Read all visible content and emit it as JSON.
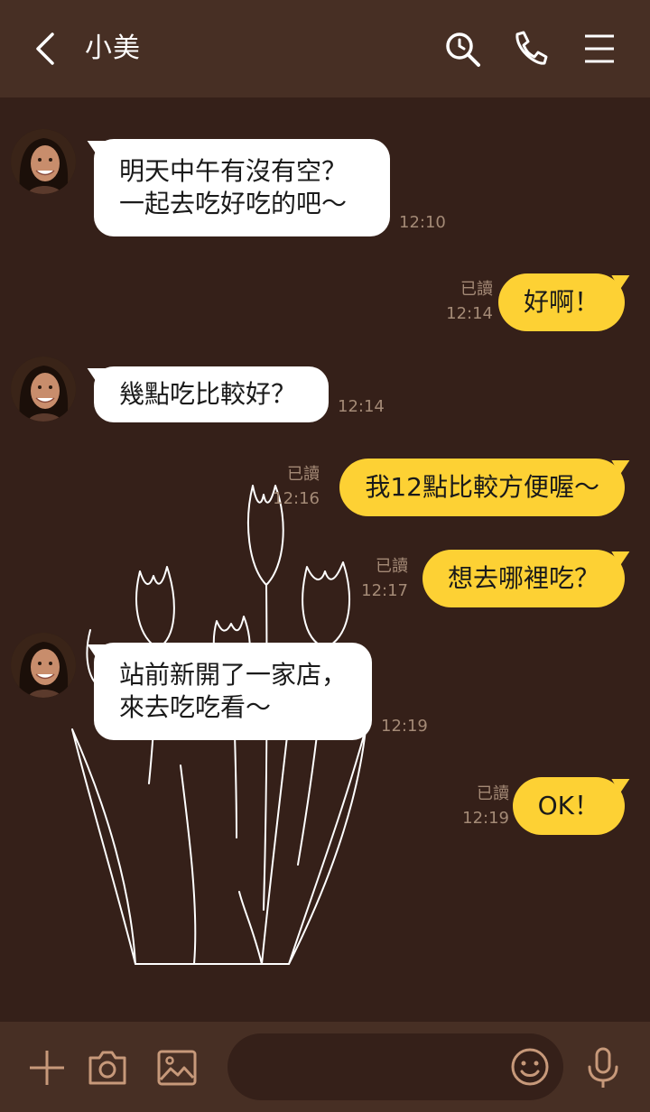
{
  "header": {
    "contact_name": "小美",
    "icons": [
      "back-icon",
      "search-icon",
      "phone-icon",
      "menu-icon"
    ]
  },
  "messages": [
    {
      "side": "in",
      "lines": [
        "明天中午有沒有空？",
        "一起去吃好吃的吧～"
      ],
      "time": "12:10"
    },
    {
      "side": "out",
      "lines": [
        "好啊！"
      ],
      "read": "已讀",
      "time": "12:14"
    },
    {
      "side": "in",
      "lines": [
        "幾點吃比較好？"
      ],
      "time": "12:14"
    },
    {
      "side": "out",
      "lines": [
        "我12點比較方便喔～"
      ],
      "read": "已讀",
      "time": "12:16"
    },
    {
      "side": "out",
      "lines": [
        "想去哪裡吃？"
      ],
      "read": "已讀",
      "time": "12:17"
    },
    {
      "side": "in",
      "lines": [
        "站前新開了一家店，",
        "來去吃吃看～"
      ],
      "time": "12:19"
    },
    {
      "side": "out",
      "lines": [
        "OK！"
      ],
      "read": "已讀",
      "time": "12:19"
    }
  ],
  "input": {
    "placeholder": "",
    "icons": [
      "plus-icon",
      "camera-icon",
      "image-icon",
      "emoji-icon",
      "microphone-icon"
    ]
  },
  "colors": {
    "header_bg": "#472f24",
    "chat_bg": "#352019",
    "out_bubble": "#fdd134",
    "in_bubble": "#ffffff",
    "meta_text": "#a48a76",
    "icon_accent": "#c7997a"
  }
}
